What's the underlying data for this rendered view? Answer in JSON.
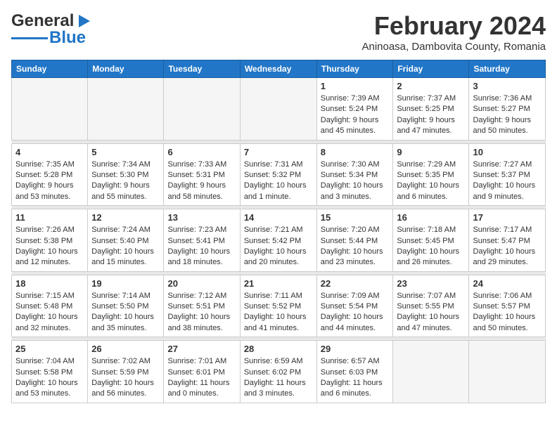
{
  "header": {
    "logo_line1": "General",
    "logo_line2": "Blue",
    "title": "February 2024",
    "subtitle": "Aninoasa, Dambovita County, Romania"
  },
  "calendar": {
    "days_of_week": [
      "Sunday",
      "Monday",
      "Tuesday",
      "Wednesday",
      "Thursday",
      "Friday",
      "Saturday"
    ],
    "weeks": [
      [
        {
          "day": "",
          "info": ""
        },
        {
          "day": "",
          "info": ""
        },
        {
          "day": "",
          "info": ""
        },
        {
          "day": "",
          "info": ""
        },
        {
          "day": "1",
          "info": "Sunrise: 7:39 AM\nSunset: 5:24 PM\nDaylight: 9 hours\nand 45 minutes."
        },
        {
          "day": "2",
          "info": "Sunrise: 7:37 AM\nSunset: 5:25 PM\nDaylight: 9 hours\nand 47 minutes."
        },
        {
          "day": "3",
          "info": "Sunrise: 7:36 AM\nSunset: 5:27 PM\nDaylight: 9 hours\nand 50 minutes."
        }
      ],
      [
        {
          "day": "4",
          "info": "Sunrise: 7:35 AM\nSunset: 5:28 PM\nDaylight: 9 hours\nand 53 minutes."
        },
        {
          "day": "5",
          "info": "Sunrise: 7:34 AM\nSunset: 5:30 PM\nDaylight: 9 hours\nand 55 minutes."
        },
        {
          "day": "6",
          "info": "Sunrise: 7:33 AM\nSunset: 5:31 PM\nDaylight: 9 hours\nand 58 minutes."
        },
        {
          "day": "7",
          "info": "Sunrise: 7:31 AM\nSunset: 5:32 PM\nDaylight: 10 hours\nand 1 minute."
        },
        {
          "day": "8",
          "info": "Sunrise: 7:30 AM\nSunset: 5:34 PM\nDaylight: 10 hours\nand 3 minutes."
        },
        {
          "day": "9",
          "info": "Sunrise: 7:29 AM\nSunset: 5:35 PM\nDaylight: 10 hours\nand 6 minutes."
        },
        {
          "day": "10",
          "info": "Sunrise: 7:27 AM\nSunset: 5:37 PM\nDaylight: 10 hours\nand 9 minutes."
        }
      ],
      [
        {
          "day": "11",
          "info": "Sunrise: 7:26 AM\nSunset: 5:38 PM\nDaylight: 10 hours\nand 12 minutes."
        },
        {
          "day": "12",
          "info": "Sunrise: 7:24 AM\nSunset: 5:40 PM\nDaylight: 10 hours\nand 15 minutes."
        },
        {
          "day": "13",
          "info": "Sunrise: 7:23 AM\nSunset: 5:41 PM\nDaylight: 10 hours\nand 18 minutes."
        },
        {
          "day": "14",
          "info": "Sunrise: 7:21 AM\nSunset: 5:42 PM\nDaylight: 10 hours\nand 20 minutes."
        },
        {
          "day": "15",
          "info": "Sunrise: 7:20 AM\nSunset: 5:44 PM\nDaylight: 10 hours\nand 23 minutes."
        },
        {
          "day": "16",
          "info": "Sunrise: 7:18 AM\nSunset: 5:45 PM\nDaylight: 10 hours\nand 26 minutes."
        },
        {
          "day": "17",
          "info": "Sunrise: 7:17 AM\nSunset: 5:47 PM\nDaylight: 10 hours\nand 29 minutes."
        }
      ],
      [
        {
          "day": "18",
          "info": "Sunrise: 7:15 AM\nSunset: 5:48 PM\nDaylight: 10 hours\nand 32 minutes."
        },
        {
          "day": "19",
          "info": "Sunrise: 7:14 AM\nSunset: 5:50 PM\nDaylight: 10 hours\nand 35 minutes."
        },
        {
          "day": "20",
          "info": "Sunrise: 7:12 AM\nSunset: 5:51 PM\nDaylight: 10 hours\nand 38 minutes."
        },
        {
          "day": "21",
          "info": "Sunrise: 7:11 AM\nSunset: 5:52 PM\nDaylight: 10 hours\nand 41 minutes."
        },
        {
          "day": "22",
          "info": "Sunrise: 7:09 AM\nSunset: 5:54 PM\nDaylight: 10 hours\nand 44 minutes."
        },
        {
          "day": "23",
          "info": "Sunrise: 7:07 AM\nSunset: 5:55 PM\nDaylight: 10 hours\nand 47 minutes."
        },
        {
          "day": "24",
          "info": "Sunrise: 7:06 AM\nSunset: 5:57 PM\nDaylight: 10 hours\nand 50 minutes."
        }
      ],
      [
        {
          "day": "25",
          "info": "Sunrise: 7:04 AM\nSunset: 5:58 PM\nDaylight: 10 hours\nand 53 minutes."
        },
        {
          "day": "26",
          "info": "Sunrise: 7:02 AM\nSunset: 5:59 PM\nDaylight: 10 hours\nand 56 minutes."
        },
        {
          "day": "27",
          "info": "Sunrise: 7:01 AM\nSunset: 6:01 PM\nDaylight: 11 hours\nand 0 minutes."
        },
        {
          "day": "28",
          "info": "Sunrise: 6:59 AM\nSunset: 6:02 PM\nDaylight: 11 hours\nand 3 minutes."
        },
        {
          "day": "29",
          "info": "Sunrise: 6:57 AM\nSunset: 6:03 PM\nDaylight: 11 hours\nand 6 minutes."
        },
        {
          "day": "",
          "info": ""
        },
        {
          "day": "",
          "info": ""
        }
      ]
    ]
  }
}
